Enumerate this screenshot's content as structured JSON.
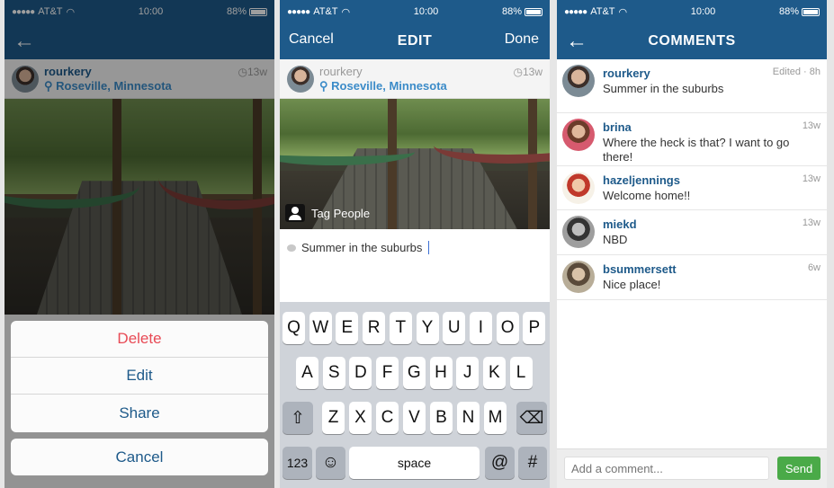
{
  "status": {
    "carrier": "AT&T",
    "time": "10:00",
    "battery": "88%",
    "battery_level": 0.88
  },
  "panel1": {
    "post": {
      "username": "rourkery",
      "location": "Roseville, Minnesota",
      "time": "13w"
    },
    "sheet": {
      "delete": "Delete",
      "edit": "Edit",
      "share": "Share",
      "cancel": "Cancel"
    }
  },
  "panel2": {
    "nav": {
      "cancel": "Cancel",
      "title": "EDIT",
      "done": "Done"
    },
    "post": {
      "username": "rourkery",
      "location": "Roseville, Minnesota",
      "time": "13w"
    },
    "tag_people": "Tag People",
    "caption": "Summer in the suburbs",
    "keyboard": {
      "row1": [
        "Q",
        "W",
        "E",
        "R",
        "T",
        "Y",
        "U",
        "I",
        "O",
        "P"
      ],
      "row2": [
        "A",
        "S",
        "D",
        "F",
        "G",
        "H",
        "J",
        "K",
        "L"
      ],
      "row3": [
        "Z",
        "X",
        "C",
        "V",
        "B",
        "N",
        "M"
      ],
      "num": "123",
      "space": "space",
      "at": "@",
      "hash": "#"
    }
  },
  "panel3": {
    "title": "COMMENTS",
    "comments": [
      {
        "user": "rourkery",
        "text": "Summer in the suburbs",
        "time": "Edited · 8h"
      },
      {
        "user": "brina",
        "text": "Where the heck is that? I want to go there!",
        "time": "13w"
      },
      {
        "user": "hazeljennings",
        "text": "Welcome home!!",
        "time": "13w"
      },
      {
        "user": "miekd",
        "text": "NBD",
        "time": "13w"
      },
      {
        "user": "bsummersett",
        "text": "Nice place!",
        "time": "6w"
      }
    ],
    "input_placeholder": "Add a comment...",
    "send": "Send"
  },
  "colors": {
    "nav": "#1e5a8a",
    "link": "#3b8bc8",
    "destructive": "#e84a55",
    "send": "#4aaa48"
  }
}
